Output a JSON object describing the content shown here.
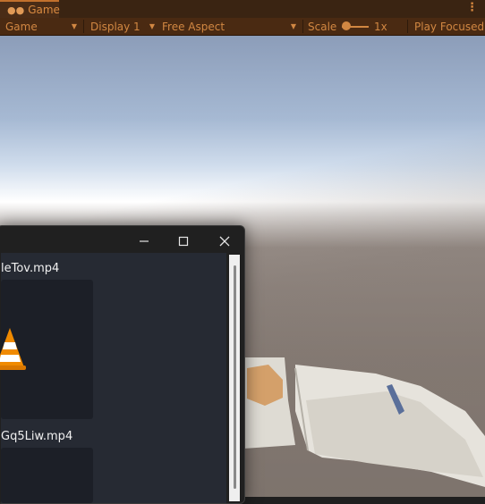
{
  "tab": {
    "label": "Game",
    "icon": "gamepad-icon"
  },
  "toolbar": {
    "view_mode": "Game",
    "display": "Display 1",
    "aspect": "Free Aspect",
    "scale_label": "Scale",
    "scale_value": "1x",
    "play_mode": "Play Focused"
  },
  "file_window": {
    "files": [
      {
        "name": "leTov.mp4",
        "icon": "vlc-cone-icon"
      },
      {
        "name": "Gq5Liw.mp4",
        "icon": "vlc-cone-icon"
      }
    ],
    "controls": [
      "minimize-icon",
      "maximize-icon",
      "close-icon"
    ]
  },
  "colors": {
    "tab_accent": "#d98a40",
    "toolbar_bg": "#4a2a12",
    "window_bg": "#202020",
    "file_area_bg": "#262a33",
    "vlc_orange": "#f08a00"
  }
}
